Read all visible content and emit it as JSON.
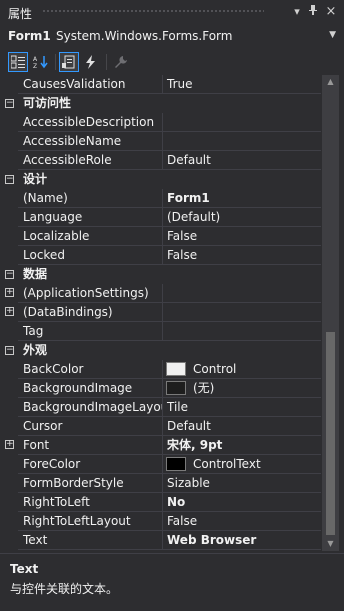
{
  "panel": {
    "title": "属性"
  },
  "object": {
    "name": "Form1",
    "type": "System.Windows.Forms.Form"
  },
  "toolbar": {
    "icons": [
      "categorized-icon",
      "alphabetical-icon",
      "properties-icon",
      "events-icon",
      "property-pages-icon"
    ]
  },
  "grid": {
    "causes_validation": {
      "name": "CausesValidation",
      "value": "True"
    },
    "cat_accessibility": "可访问性",
    "accessible_description": {
      "name": "AccessibleDescription",
      "value": ""
    },
    "accessible_name": {
      "name": "AccessibleName",
      "value": ""
    },
    "accessible_role": {
      "name": "AccessibleRole",
      "value": "Default"
    },
    "cat_design": "设计",
    "name_prop": {
      "name": "(Name)",
      "value": "Form1"
    },
    "language": {
      "name": "Language",
      "value": "(Default)"
    },
    "localizable": {
      "name": "Localizable",
      "value": "False"
    },
    "locked": {
      "name": "Locked",
      "value": "False"
    },
    "cat_data": "数据",
    "application_settings": {
      "name": "(ApplicationSettings)",
      "value": ""
    },
    "data_bindings": {
      "name": "(DataBindings)",
      "value": ""
    },
    "tag": {
      "name": "Tag",
      "value": ""
    },
    "cat_appearance": "外观",
    "back_color": {
      "name": "BackColor",
      "value": "Control",
      "swatch": "#f0f0f0"
    },
    "background_image": {
      "name": "BackgroundImage",
      "value": "(无)",
      "swatch": "#1e1e1e"
    },
    "background_image_layout": {
      "name": "BackgroundImageLayout",
      "value": "Tile"
    },
    "cursor": {
      "name": "Cursor",
      "value": "Default"
    },
    "font": {
      "name": "Font",
      "value": "宋体, 9pt"
    },
    "fore_color": {
      "name": "ForeColor",
      "value": "ControlText",
      "swatch": "#000000"
    },
    "form_border_style": {
      "name": "FormBorderStyle",
      "value": "Sizable"
    },
    "right_to_left": {
      "name": "RightToLeft",
      "value": "No"
    },
    "right_to_left_layout": {
      "name": "RightToLeftLayout",
      "value": "False"
    },
    "text": {
      "name": "Text",
      "value": "Web Browser"
    }
  },
  "description": {
    "title": "Text",
    "text": "与控件关联的文本。"
  },
  "colors": {
    "background": "#2d2d30",
    "gridline": "#3f3f46",
    "accent": "#3399ff"
  }
}
